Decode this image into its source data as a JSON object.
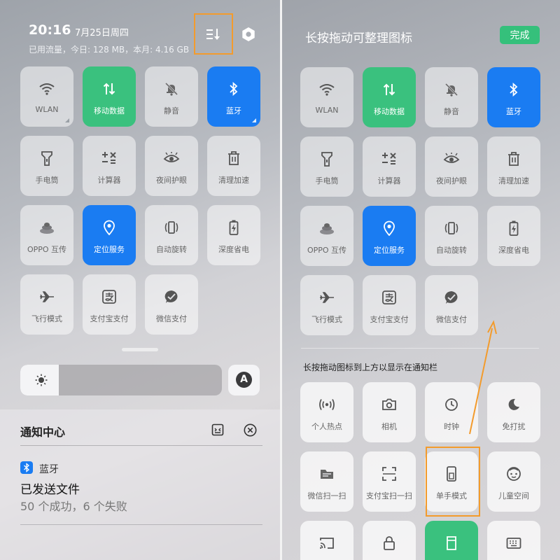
{
  "left": {
    "time": "20:16",
    "date": "7月25日周四",
    "data_usage": "已用流量，今日: 128 MB，本月: 4.16 GB",
    "tiles": [
      {
        "label": "WLAN",
        "icon": "wifi-icon"
      },
      {
        "label": "移动数据",
        "icon": "mobile-data-icon"
      },
      {
        "label": "静音",
        "icon": "bell-off-icon"
      },
      {
        "label": "蓝牙",
        "icon": "bluetooth-icon"
      },
      {
        "label": "手电筒",
        "icon": "flashlight-icon"
      },
      {
        "label": "计算器",
        "icon": "calculator-icon"
      },
      {
        "label": "夜间护眼",
        "icon": "eye-icon"
      },
      {
        "label": "清理加速",
        "icon": "trash-icon"
      },
      {
        "label": "OPPO 互传",
        "icon": "oppo-share-icon"
      },
      {
        "label": "定位服务",
        "icon": "location-icon"
      },
      {
        "label": "自动旋转",
        "icon": "rotate-icon"
      },
      {
        "label": "深度省电",
        "icon": "battery-icon"
      },
      {
        "label": "飞行模式",
        "icon": "airplane-icon"
      },
      {
        "label": "支付宝支付",
        "icon": "alipay-icon"
      },
      {
        "label": "微信支付",
        "icon": "wechat-pay-icon"
      }
    ],
    "brightness_level": 0.19,
    "auto_brightness_label": "A",
    "notification_center": {
      "title": "通知中心",
      "notification": {
        "app": "蓝牙",
        "title": "已发送文件",
        "body": "50 个成功，6 个失败"
      }
    }
  },
  "right": {
    "title": "长按拖动可整理图标",
    "done_label": "完成",
    "tiles": [
      {
        "label": "WLAN",
        "icon": "wifi-icon"
      },
      {
        "label": "移动数据",
        "icon": "mobile-data-icon"
      },
      {
        "label": "静音",
        "icon": "bell-off-icon"
      },
      {
        "label": "蓝牙",
        "icon": "bluetooth-icon"
      },
      {
        "label": "手电筒",
        "icon": "flashlight-icon"
      },
      {
        "label": "计算器",
        "icon": "calculator-icon"
      },
      {
        "label": "夜间护眼",
        "icon": "eye-icon"
      },
      {
        "label": "清理加速",
        "icon": "trash-icon"
      },
      {
        "label": "OPPO 互传",
        "icon": "oppo-share-icon"
      },
      {
        "label": "定位服务",
        "icon": "location-icon"
      },
      {
        "label": "自动旋转",
        "icon": "rotate-icon"
      },
      {
        "label": "深度省电",
        "icon": "battery-icon"
      },
      {
        "label": "飞行模式",
        "icon": "airplane-icon"
      },
      {
        "label": "支付宝支付",
        "icon": "alipay-icon"
      },
      {
        "label": "微信支付",
        "icon": "wechat-pay-icon"
      }
    ],
    "extra_hint": "长按拖动图标到上方以显示在通知栏",
    "extra_tiles": [
      {
        "label": "个人热点",
        "icon": "hotspot-icon"
      },
      {
        "label": "相机",
        "icon": "camera-icon"
      },
      {
        "label": "时钟",
        "icon": "clock-icon"
      },
      {
        "label": "免打扰",
        "icon": "moon-icon"
      },
      {
        "label": "微信扫一扫",
        "icon": "wechat-scan-icon"
      },
      {
        "label": "支付宝扫一扫",
        "icon": "scan-icon"
      },
      {
        "label": "单手模式",
        "icon": "one-hand-icon"
      },
      {
        "label": "儿童空间",
        "icon": "kids-space-icon"
      },
      {
        "label": "",
        "icon": "cast-icon"
      },
      {
        "label": "",
        "icon": "lock-icon"
      },
      {
        "label": "",
        "icon": "sd-card-icon"
      },
      {
        "label": "",
        "icon": "keyboard-icon"
      }
    ]
  },
  "colors": {
    "active_green": "#3ac17e",
    "active_blue": "#1a7cf2",
    "done_green": "#35c07b",
    "highlight_orange": "#f39b2c"
  }
}
